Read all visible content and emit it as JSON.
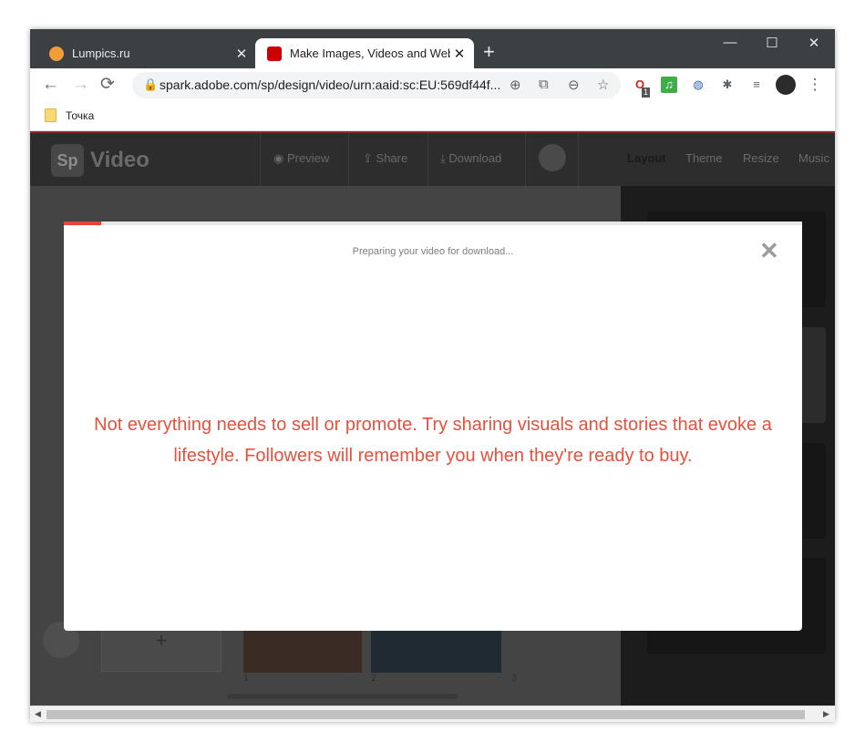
{
  "browser": {
    "tabs": [
      {
        "title": "Lumpics.ru",
        "favicon_color": "#f29d38"
      },
      {
        "title": "Make Images, Videos and Web S",
        "favicon_color": "#cc0000"
      }
    ],
    "new_tab_glyph": "+",
    "close_glyph": "✕",
    "window_controls": {
      "minimize": "—",
      "maximize": "☐",
      "close": "✕"
    },
    "nav": {
      "back": "←",
      "forward": "→",
      "reload": "⟳"
    },
    "url": "spark.adobe.com/sp/design/video/urn:aaid:sc:EU:569df44f...",
    "lock_icon": "🔒",
    "omnibox_icons": [
      "⊕",
      "⧉",
      "⊖",
      "☆"
    ],
    "extensions": [
      {
        "name": "opera-extension-icon",
        "glyph": "O",
        "color": "#d62020",
        "badge": "1"
      },
      {
        "name": "music-extension-icon",
        "glyph": "♫",
        "color": "#3fae49"
      },
      {
        "name": "globe-extension-icon",
        "glyph": "◍",
        "color": "#2e63c7"
      },
      {
        "name": "puzzle-extension-icon",
        "glyph": "✱",
        "color": "#5f6368"
      },
      {
        "name": "media-queue-icon",
        "glyph": "≡",
        "color": "#5f6368"
      }
    ],
    "menu_glyph": "⋮",
    "bookmark": {
      "label": "Точка"
    }
  },
  "spark": {
    "brand_badge": "Sp",
    "brand_title": "Video",
    "toolbar": {
      "preview": "Preview",
      "share": "Share",
      "download": "Download",
      "preview_glyph": "◉",
      "share_glyph": "⇪",
      "download_glyph": "⤓"
    },
    "right_tabs": [
      "Layout",
      "Theme",
      "Resize",
      "Music"
    ],
    "slide_numbers": [
      "1",
      "2",
      "3"
    ],
    "add_glyph": "+"
  },
  "modal": {
    "status": "Preparing your video for download...",
    "close_glyph": "✕",
    "progress": 0.05,
    "quote": "Not everything needs to sell or promote. Try sharing visuals and stories that evoke a lifestyle. Followers will remember you when they're ready to buy."
  },
  "colors": {
    "accent": "#e8433a",
    "quote_text": "#e7503d",
    "tab_strip": "#3c4043"
  }
}
